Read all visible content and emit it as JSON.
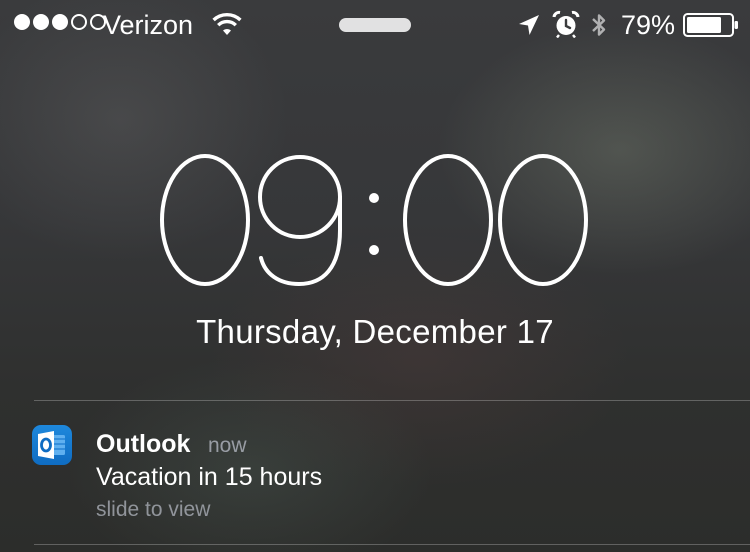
{
  "status_bar": {
    "signal_bars_filled": 3,
    "signal_bars_total": 5,
    "carrier": "Verizon",
    "battery_percent_label": "79%",
    "battery_level": 0.79
  },
  "lock_screen": {
    "time": "09:00",
    "date": "Thursday, December 17"
  },
  "notification": {
    "app": "Outlook",
    "time_ago": "now",
    "message": "Vacation in 15 hours",
    "hint": "slide to view"
  },
  "colors": {
    "outlook_blue": "#0f6cc2",
    "muted_text": "#b9bec8"
  },
  "icons": [
    "wifi-icon",
    "location-arrow-icon",
    "alarm-clock-icon",
    "bluetooth-icon",
    "battery-icon",
    "outlook-app-icon"
  ]
}
